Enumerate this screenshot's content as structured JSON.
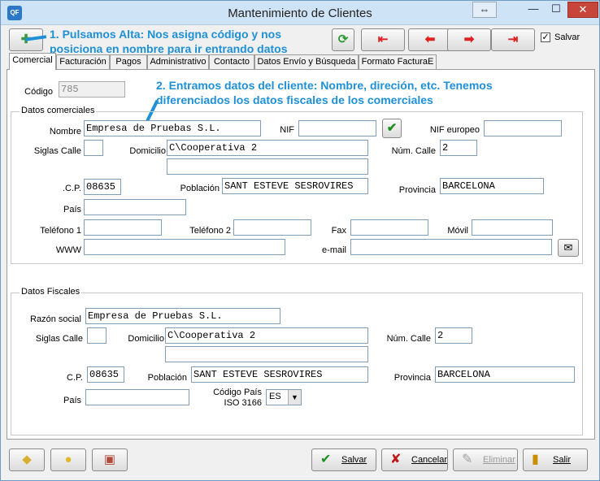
{
  "window": {
    "title": "Mantenimiento de Clientes",
    "app_icon_text": "QF"
  },
  "toolbar": {
    "salvar_label": "Salvar",
    "salvar_checked": true
  },
  "annotations": {
    "one": "1. Pulsamos Alta: Nos asigna código y nos posiciona en nombre para ir entrando datos",
    "two": "2. Entramos datos del cliente: Nombre, direción, etc. Tenemos diferenciados los datos fiscales de los comerciales"
  },
  "tabs": [
    "Comercial",
    "Facturación",
    "Pagos",
    "Administrativo",
    "Contacto",
    "Datos Envío y Búsqueda",
    "Formato FacturaE"
  ],
  "codigo": {
    "label": "Código",
    "value": "785"
  },
  "comerciales": {
    "group_label": "Datos comerciales",
    "nombre_label": "Nombre",
    "nombre": "Empresa de Pruebas S.L.",
    "nif_label": "NIF",
    "nif": "",
    "nif_europeo_label": "NIF europeo",
    "nif_europeo": "",
    "siglas_label": "Siglas Calle",
    "siglas": "",
    "domicilio_label": "Domicilio",
    "domicilio": "C\\Cooperativa 2",
    "domicilio2": "",
    "num_calle_label": "Núm. Calle",
    "num_calle": "2",
    "cp_label": ".C.P.",
    "cp": "08635",
    "poblacion_label": "Población",
    "poblacion": "SANT ESTEVE SESROVIRES",
    "provincia_label": "Provincia",
    "provincia": "BARCELONA",
    "pais_label": "País",
    "pais": "",
    "tel1_label": "Teléfono 1",
    "tel1": "",
    "tel2_label": "Teléfono 2",
    "tel2": "",
    "fax_label": "Fax",
    "fax": "",
    "movil_label": "Móvil",
    "movil": "",
    "www_label": "WWW",
    "www": "",
    "email_label": "e-mail",
    "email": ""
  },
  "fiscales": {
    "group_label": "Datos Fiscales",
    "razon_label": "Razón social",
    "razon": "Empresa de Pruebas S.L.",
    "siglas_label": "Siglas Calle",
    "siglas": "",
    "domicilio_label": "Domicilio",
    "domicilio": "C\\Cooperativa 2",
    "domicilio2": "",
    "num_calle_label": "Núm. Calle",
    "num_calle": "2",
    "cp_label": "C.P.",
    "cp": "08635",
    "poblacion_label": "Población",
    "poblacion": "SANT ESTEVE SESROVIRES",
    "provincia_label": "Provincia",
    "provincia": "BARCELONA",
    "pais_label": "País",
    "pais": "",
    "codigo_pais_label1": "Código País",
    "codigo_pais_label2": "ISO 3166",
    "codigo_pais": "ES"
  },
  "bottom": {
    "salvar": "Salvar",
    "cancelar": "Cancelar",
    "eliminar": "Eliminar",
    "salir": "Salir"
  }
}
